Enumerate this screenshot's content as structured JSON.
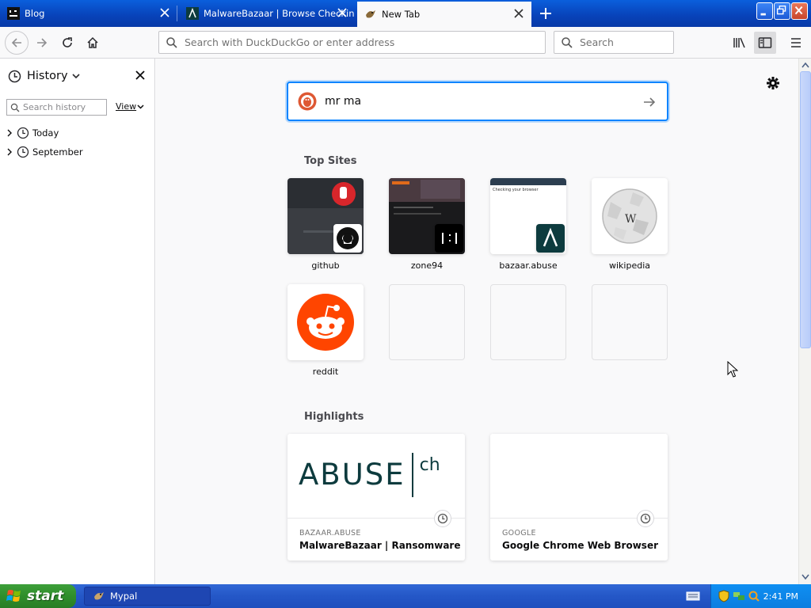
{
  "window": {
    "tabs": [
      {
        "label": "Blog",
        "active": false
      },
      {
        "label": "MalwareBazaar | Browse Checking",
        "active": false
      },
      {
        "label": "New Tab",
        "active": true
      }
    ]
  },
  "toolbar": {
    "url_placeholder": "Search with DuckDuckGo or enter address",
    "search_placeholder": "Search"
  },
  "sidebar": {
    "title": "History",
    "search_placeholder": "Search history",
    "view_label": "View",
    "groups": [
      {
        "label": "Today"
      },
      {
        "label": "September"
      }
    ]
  },
  "newtab": {
    "search_value": "mr ma",
    "top_sites_title": "Top Sites",
    "top_sites": [
      {
        "label": "github"
      },
      {
        "label": "zone94"
      },
      {
        "label": "bazaar.abuse"
      },
      {
        "label": "wikipedia"
      },
      {
        "label": "reddit"
      },
      {
        "label": ""
      },
      {
        "label": ""
      },
      {
        "label": ""
      }
    ],
    "bazaar_thumb_text": "Checking your browser",
    "highlights_title": "Highlights",
    "highlights": [
      {
        "source": "BAZAAR.ABUSE",
        "title": "MalwareBazaar | Ransomware",
        "logo_main": "ABUSE",
        "logo_sub": "ch"
      },
      {
        "source": "GOOGLE",
        "title": "Google Chrome Web Browser"
      }
    ]
  },
  "taskbar": {
    "start_label": "start",
    "task_label": "Mypal",
    "clock": "2:41 PM"
  },
  "colors": {
    "accent": "#0a84ff",
    "titlebar": "#0842b8",
    "taskbar": "#2457c7",
    "start_green": "#2f8e2b",
    "reddit": "#ff4500"
  }
}
